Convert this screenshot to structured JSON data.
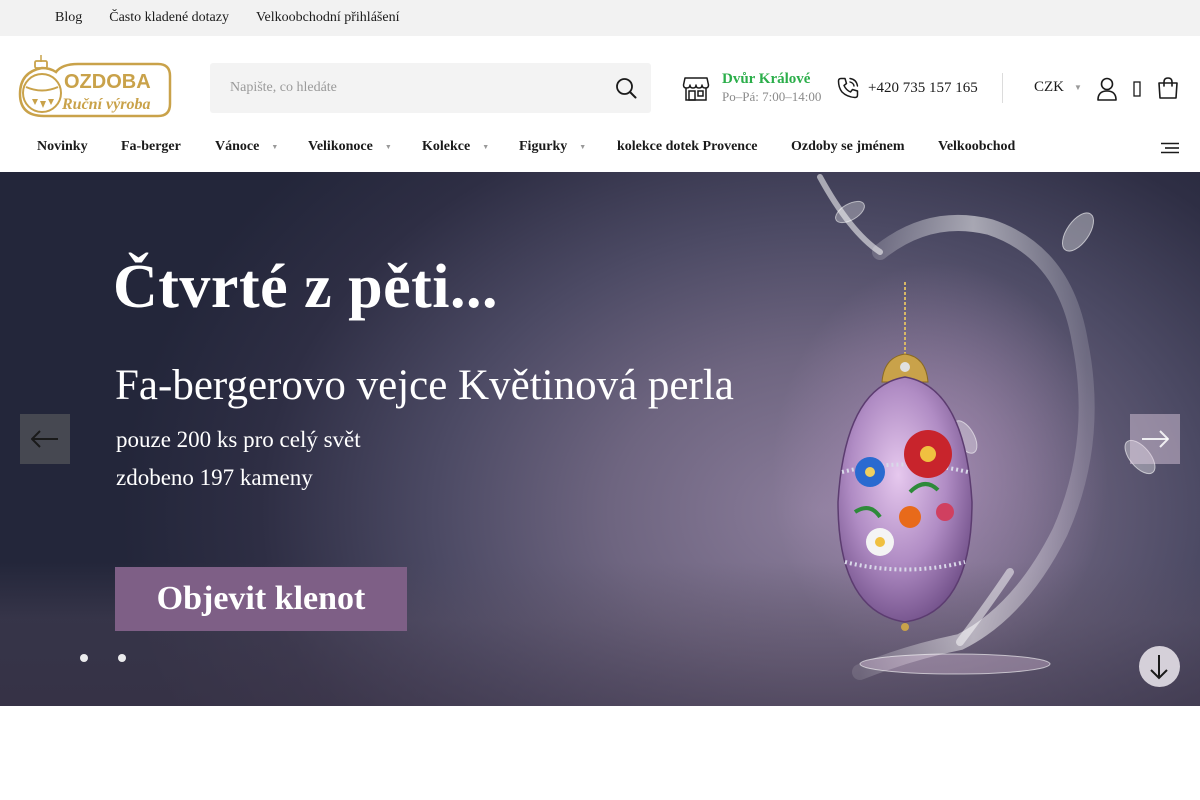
{
  "topbar": {
    "links": [
      "Blog",
      "Často kladené dotazy",
      "Velkoobchodní přihlášení"
    ]
  },
  "header": {
    "logo": {
      "line1": "OZDOBA",
      "line2": "Ruční výroba"
    },
    "search": {
      "placeholder": "Napište, co hledáte"
    },
    "store": {
      "name": "Dvůr Králové",
      "hours": "Po–Pá: 7:00–14:00"
    },
    "phone": "+420 735 157 165",
    "currency": "CZK"
  },
  "nav": {
    "items": [
      {
        "label": "Novinky",
        "dropdown": false
      },
      {
        "label": "Fa-berger",
        "dropdown": false
      },
      {
        "label": "Vánoce",
        "dropdown": true
      },
      {
        "label": "Velikonoce",
        "dropdown": true
      },
      {
        "label": "Kolekce",
        "dropdown": true
      },
      {
        "label": "Figurky",
        "dropdown": true
      },
      {
        "label": "kolekce dotek Provence",
        "dropdown": false
      },
      {
        "label": "Ozdoby se jménem",
        "dropdown": false
      },
      {
        "label": "Velkoobchod",
        "dropdown": false
      }
    ]
  },
  "hero": {
    "headline": "Čtvrté z pěti...",
    "subhead": "Fa-bergerovo vejce Květinová perla",
    "line1": "pouze 200 ks pro celý svět",
    "line2": "zdobeno 197 kameny",
    "cta": "Objevit klenot",
    "slide_count": 2,
    "active_slide": 1
  },
  "colors": {
    "store_green": "#2bae4a",
    "cta_purple": "#7e5f86",
    "logo_gold": "#c9a24a",
    "topbar_bg": "#f2f2f2"
  },
  "icons": [
    "search-icon",
    "store-icon",
    "phone-icon",
    "chevron-down-icon",
    "user-icon",
    "heart-icon",
    "cart-icon",
    "menu-icon",
    "arrow-left-icon",
    "arrow-right-icon",
    "arrow-down-icon"
  ]
}
